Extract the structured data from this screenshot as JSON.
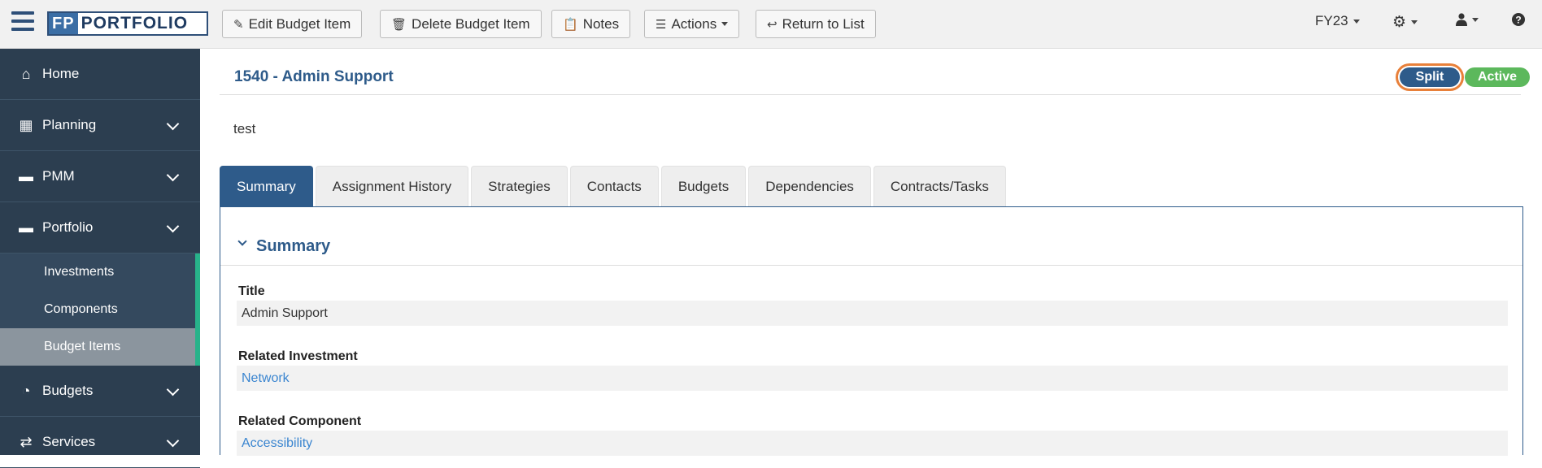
{
  "logo": {
    "prefix": "FP",
    "name": "PORTFOLIO"
  },
  "toolbar": {
    "edit_label": "Edit Budget Item",
    "delete_label": "Delete Budget Item",
    "notes_label": "Notes",
    "actions_label": "Actions",
    "return_label": "Return to List"
  },
  "topright": {
    "fiscal_year": "FY23"
  },
  "sidebar": {
    "items": [
      {
        "label": "Home",
        "icon": "home-icon"
      },
      {
        "label": "Planning",
        "icon": "table-icon"
      },
      {
        "label": "PMM",
        "icon": "folder-icon"
      },
      {
        "label": "Portfolio",
        "icon": "folder-icon"
      },
      {
        "label": "Budgets",
        "icon": "pie-chart-icon"
      },
      {
        "label": "Services",
        "icon": "exchange-icon"
      }
    ],
    "portfolio_sub": [
      "Investments",
      "Components",
      "Budget Items"
    ]
  },
  "item": {
    "title": "1540 - Admin Support",
    "description": "test",
    "badges": {
      "split": "Split",
      "active": "Active"
    }
  },
  "tabs": [
    "Summary",
    "Assignment History",
    "Strategies",
    "Contacts",
    "Budgets",
    "Dependencies",
    "Contracts/Tasks"
  ],
  "summary": {
    "heading": "Summary",
    "fields": [
      {
        "label": "Title",
        "value": "Admin Support"
      },
      {
        "label": "Related Investment",
        "value": "Network"
      },
      {
        "label": "Related Component",
        "value": "Accessibility"
      }
    ]
  },
  "colors": {
    "primary": "#2e5b8a",
    "sidebar": "#2c3e50",
    "success": "#5cb85c",
    "highlight": "#e8803a",
    "link": "#3a85d0"
  }
}
